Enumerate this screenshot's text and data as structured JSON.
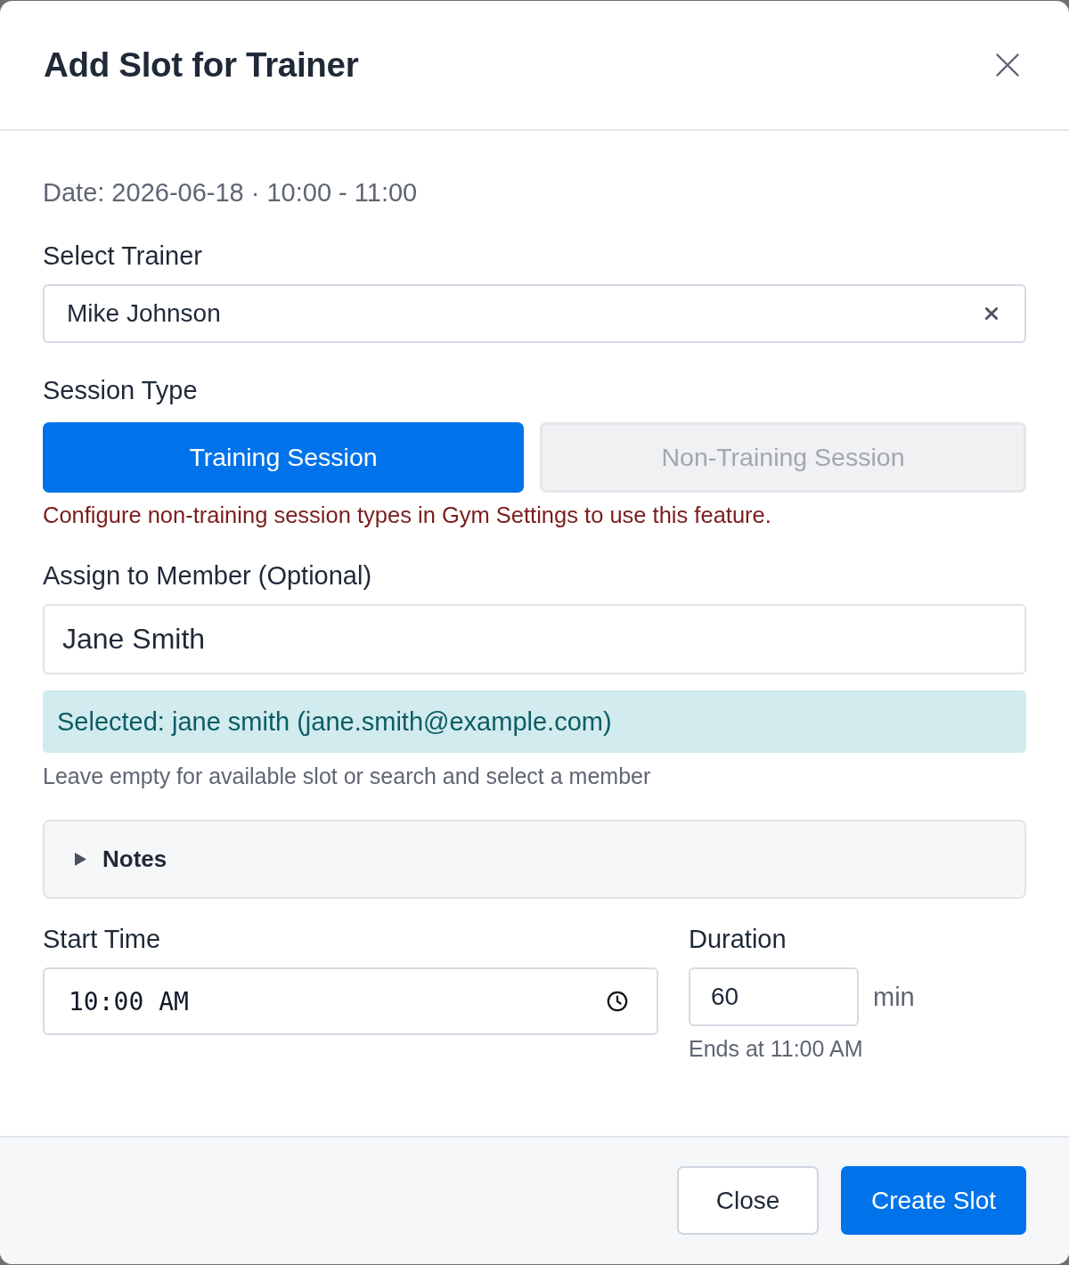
{
  "dialog": {
    "title": "Add Slot for Trainer"
  },
  "date_line": "Date: 2026-06-18 · 10:00 - 11:00",
  "trainer": {
    "label": "Select Trainer",
    "value": "Mike Johnson"
  },
  "session_type": {
    "label": "Session Type",
    "options": [
      {
        "label": "Training Session",
        "selected": true,
        "disabled": false
      },
      {
        "label": "Non-Training Session",
        "selected": false,
        "disabled": true
      }
    ],
    "error": "Configure non-training session types in Gym Settings to use this feature."
  },
  "member": {
    "label": "Assign to Member (Optional)",
    "value": "Jane Smith",
    "selected_notice": "Selected: jane smith (jane.smith@example.com)",
    "help": "Leave empty for available slot or search and select a member"
  },
  "notes": {
    "label": "Notes",
    "expanded": false
  },
  "start_time": {
    "label": "Start Time",
    "value": "10:00 AM"
  },
  "duration": {
    "label": "Duration",
    "value": "60",
    "unit": "min",
    "hint": "Ends at 11:00 AM"
  },
  "buttons": [
    {
      "label": "Close",
      "kind": "secondary"
    },
    {
      "label": "Create Slot",
      "kind": "primary"
    }
  ]
}
